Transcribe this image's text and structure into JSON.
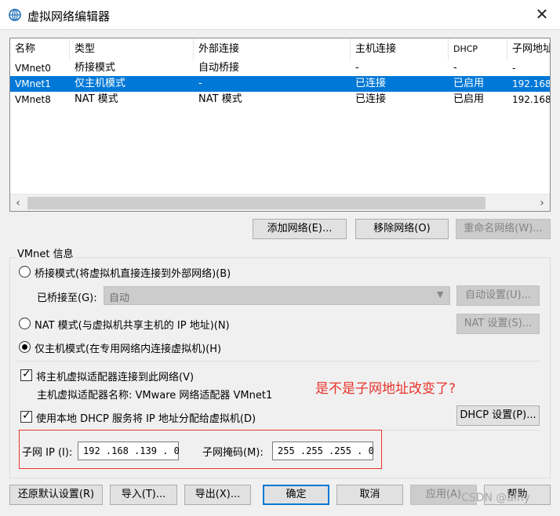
{
  "window": {
    "title": "虚拟网络编辑器",
    "close_glyph": "✕"
  },
  "columns": [
    "名称",
    "类型",
    "外部连接",
    "主机连接",
    "DHCP",
    "子网地址"
  ],
  "rows": [
    {
      "name": "VMnet0",
      "type": "桥接模式",
      "external": "自动桥接",
      "host": "-",
      "dhcp": "-",
      "subnet": "-",
      "selected": false
    },
    {
      "name": "VMnet1",
      "type": "仅主机模式",
      "external": "-",
      "host": "已连接",
      "dhcp": "已启用",
      "subnet": "192.168.",
      "selected": true
    },
    {
      "name": "VMnet8",
      "type": "NAT 模式",
      "external": "NAT 模式",
      "host": "已连接",
      "dhcp": "已启用",
      "subnet": "192.168.",
      "selected": false
    }
  ],
  "list_buttons": {
    "add": "添加网络(E)...",
    "remove": "移除网络(O)",
    "rename": "重命名网络(W)..."
  },
  "group": {
    "label": "VMnet 信息",
    "bridged_radio": "桥接模式(将虚拟机直接连接到外部网络)(B)",
    "bridged_to_label": "已桥接至(G):",
    "bridged_to_value": "自动",
    "auto_settings_button": "自动设置(U)...",
    "nat_radio": "NAT 模式(与虚拟机共享主机的 IP 地址)(N)",
    "nat_settings_button": "NAT 设置(S)...",
    "hostonly_radio": "仅主机模式(在专用网络内连接虚拟机)(H)",
    "connect_adapter_check": "将主机虚拟适配器连接到此网络(V)",
    "adapter_name": "主机虚拟适配器名称: VMware 网络适配器 VMnet1",
    "dhcp_check": "使用本地 DHCP 服务将 IP 地址分配给虚拟机(D)",
    "dhcp_settings_button": "DHCP 设置(P)...",
    "subnet_ip_label": "子网 IP (I):",
    "subnet_ip_value": "192 .168 .139 .  0",
    "subnet_mask_label": "子网掩码(M):",
    "subnet_mask_value": "255 .255 .255 .  0"
  },
  "annotation": "是不是子网地址改变了?",
  "footer_buttons": {
    "restore": "还原默认设置(R)",
    "import": "导入(T)...",
    "export": "导出(X)...",
    "ok": "确定",
    "cancel": "取消",
    "apply": "应用(A)",
    "help": "帮助"
  },
  "watermark": "CSDN @alfiy",
  "colors": {
    "selection": "#0078d7",
    "annotation": "#e8352b"
  }
}
